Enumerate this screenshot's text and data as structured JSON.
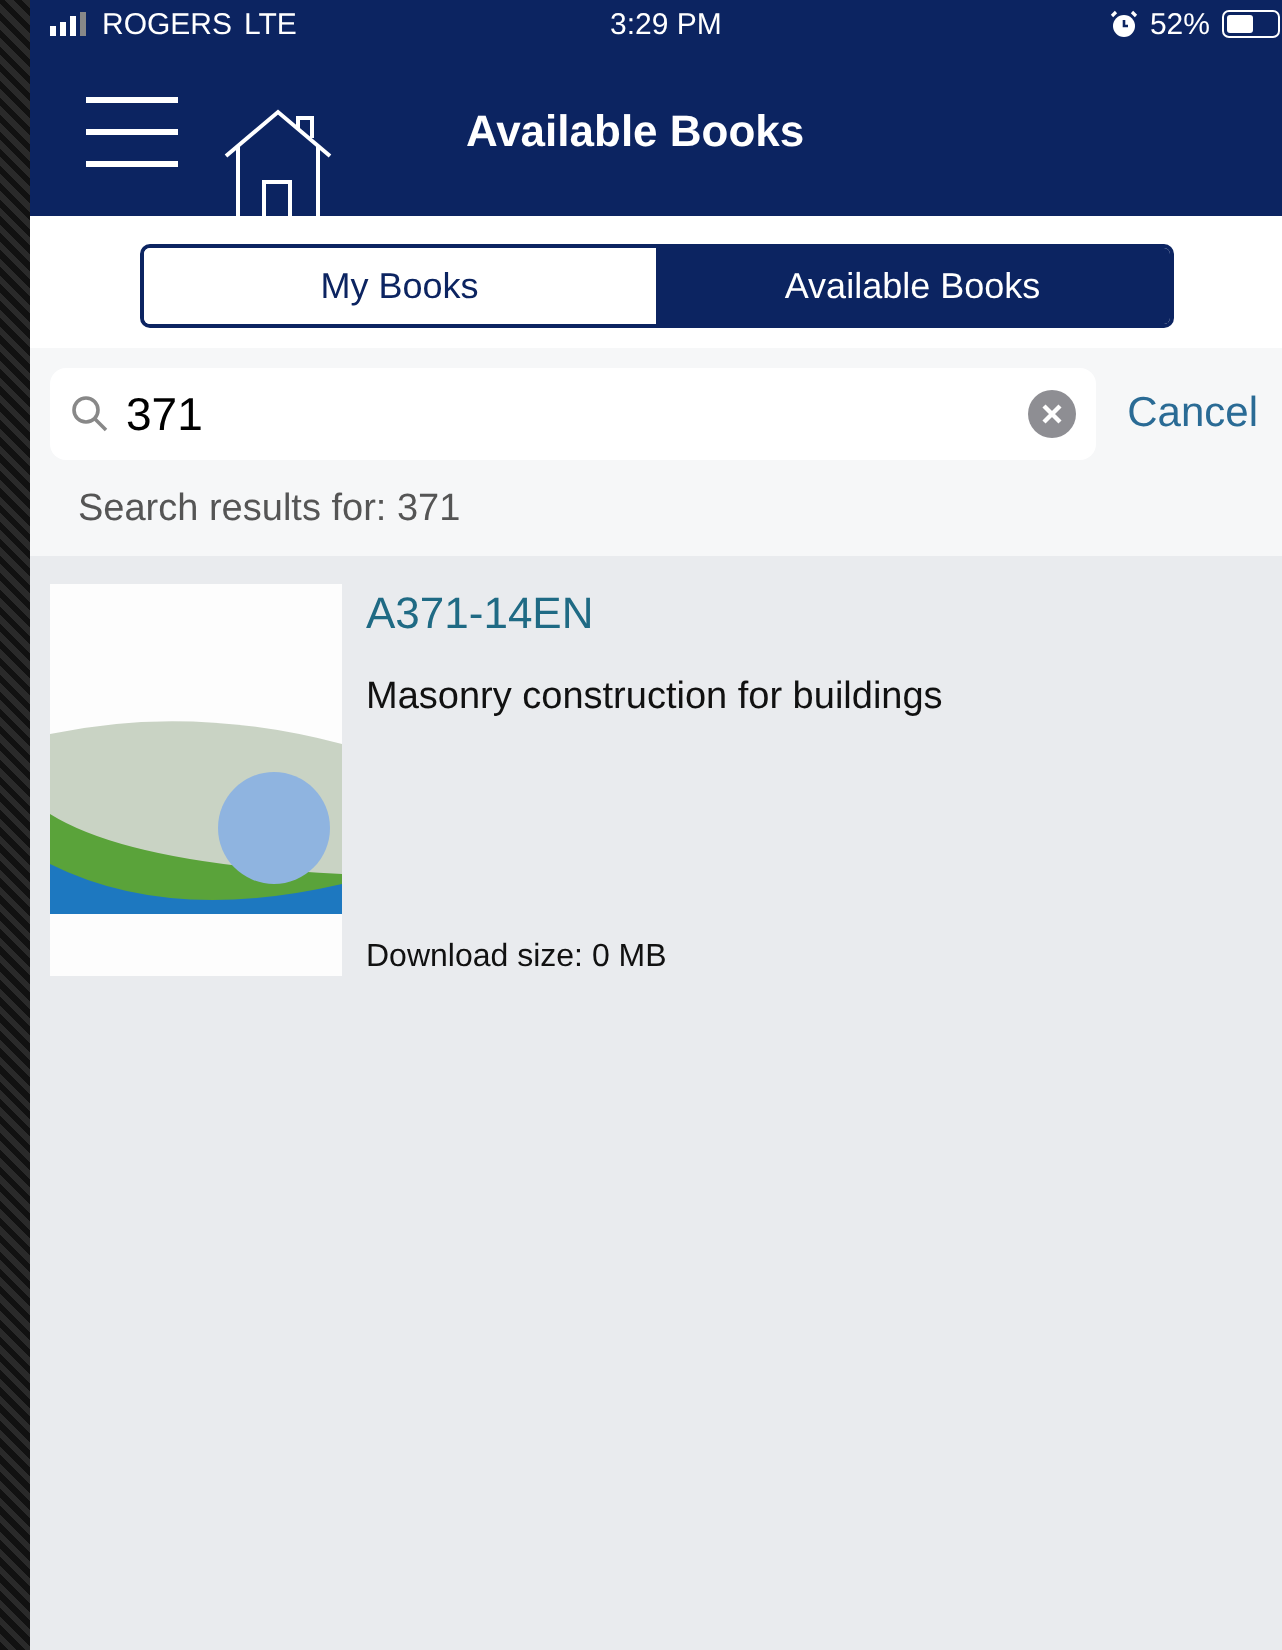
{
  "status_bar": {
    "carrier": "ROGERS",
    "network": "LTE",
    "time": "3:29 PM",
    "battery": "52%"
  },
  "nav_bar": {
    "title": "Available Books"
  },
  "segments": [
    {
      "label": "My Books",
      "selected": false
    },
    {
      "label": "Available Books",
      "selected": true
    }
  ],
  "search": {
    "value": "371",
    "cancel": "Cancel"
  },
  "results_label": "Search results for: 371",
  "books": [
    {
      "code": "A371-14EN",
      "title": "Masonry construction for buildings",
      "download_size": "Download size: 0 MB"
    }
  ]
}
